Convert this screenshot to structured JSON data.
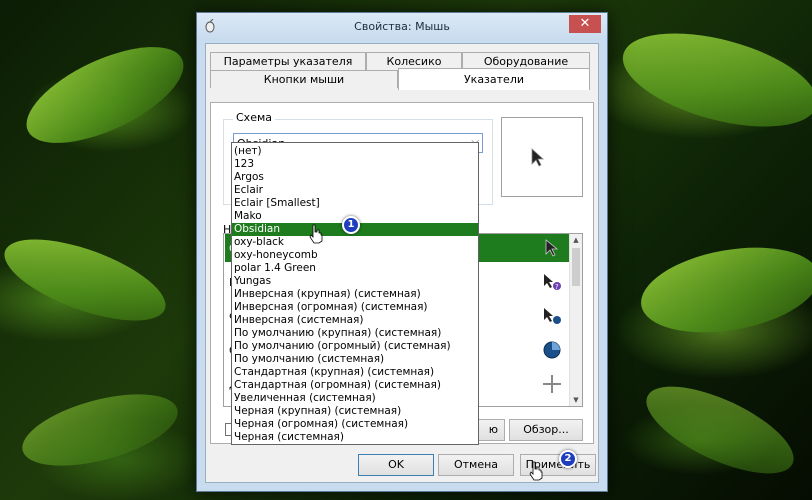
{
  "window": {
    "title": "Свойства: Мышь",
    "close_label": "✕"
  },
  "tabs": {
    "row_back": [
      "Параметры указателя",
      "Колесико",
      "Оборудование"
    ],
    "row_front": [
      "Кнопки мыши",
      "Указатели"
    ],
    "active": "Указатели"
  },
  "scheme": {
    "group_label": "Схема",
    "selected": "Obsidian",
    "options": [
      "(нет)",
      "123",
      "Argos",
      "Eclair",
      "Eclair [Smallest]",
      "Mako",
      "Obsidian",
      "oxy-black",
      "oxy-honeycomb",
      "polar 1.4 Green",
      "Yungas",
      "Инверсная (крупная) (системная)",
      "Инверсная (огромная) (системная)",
      "Инверсная (системная)",
      "По умолчанию (крупная) (системная)",
      "По умолчанию (огромный) (системная)",
      "По умолчанию (системная)",
      "Стандартная (крупная) (системная)",
      "Стандартная (огромная) (системная)",
      "Увеличенная (системная)",
      "Черная (крупная) (системная)",
      "Черная (огромная) (системная)",
      "Черная (системная)"
    ]
  },
  "customize": {
    "label_start": "Н",
    "row_partials": [
      "О",
      "Г",
      "Ф",
      "О",
      "Д",
      "Т"
    ],
    "cursor_icons": [
      "arrow-cursor-icon",
      "help-cursor-icon",
      "working-cursor-icon",
      "busy-cursor-icon",
      "crosshair-cursor-icon"
    ]
  },
  "buttons": {
    "defaults_partial": "ю",
    "browse": "Обзор...",
    "ok": "OK",
    "cancel": "Отмена",
    "apply": "Применить"
  },
  "annotations": {
    "step1": "1",
    "step2": "2"
  },
  "colors": {
    "selection": "#1e7b1e",
    "badge": "#1f3dbf",
    "title_bar": "#c7dbee",
    "close_button": "#c75050"
  }
}
